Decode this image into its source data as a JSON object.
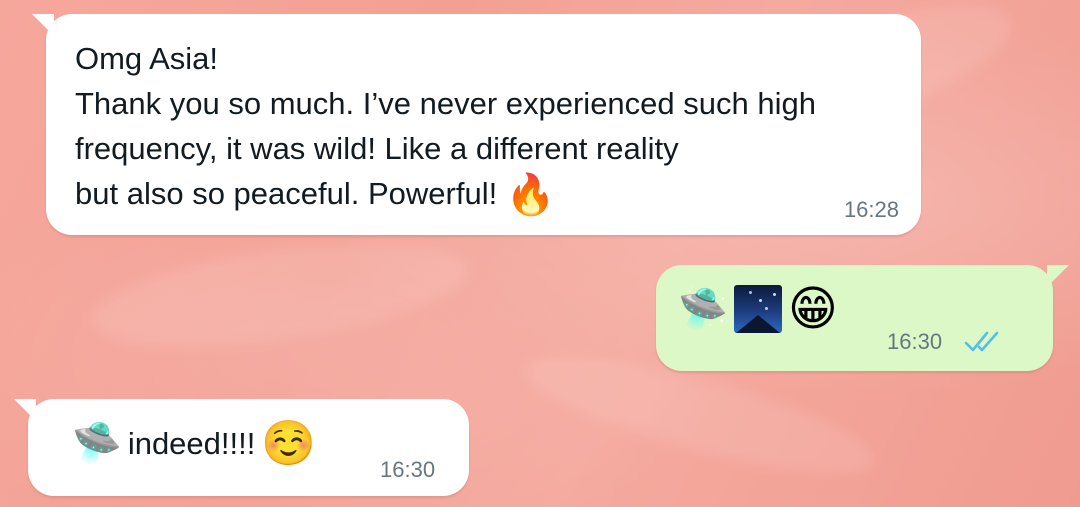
{
  "chat": {
    "messages": [
      {
        "direction": "incoming",
        "text": "Omg Asia!\nThank you so much. I’ve never experienced such high frequency, it was wild! Like a different reality\nbut also so peaceful. Powerful!",
        "emoji": "🔥",
        "time": "16:28"
      },
      {
        "direction": "outgoing",
        "emojis": [
          "🛸",
          "night-landscape-image",
          "😁"
        ],
        "time": "16:30",
        "status": "read"
      },
      {
        "direction": "incoming",
        "lead_emoji": "🛸",
        "text": "indeed!!!!",
        "trail_emoji": "☺️",
        "time": "16:30"
      }
    ]
  },
  "colors": {
    "incoming_bubble": "#ffffff",
    "outgoing_bubble": "#dcf8c6",
    "read_ticks": "#53bdeb",
    "background": "#f5a89d"
  },
  "icons": {
    "read_status": "double-check-icon"
  }
}
